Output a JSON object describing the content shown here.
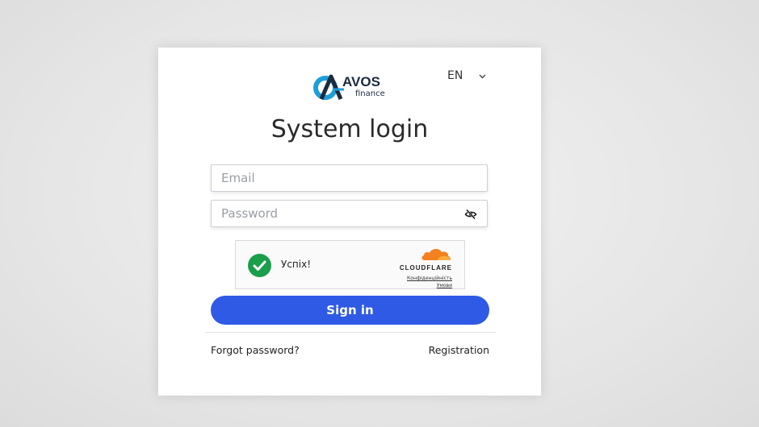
{
  "language": {
    "selected": "EN"
  },
  "logo": {
    "main": "AVOS",
    "sub": "finance",
    "colors": [
      "#1e9fd8",
      "#1b2a3f"
    ]
  },
  "title": "System login",
  "form": {
    "email_placeholder": "Email",
    "password_placeholder": "Password"
  },
  "captcha": {
    "status": "Успіх!",
    "brand": "CLOUDFLARE",
    "privacy_link": "Конфіденційність",
    "terms_link": "Умови",
    "brand_color": "#f48120",
    "success_color": "#1a9e4b"
  },
  "actions": {
    "sign_in": "Sign in",
    "forgot_password": "Forgot password?",
    "registration": "Registration",
    "accent": "#2f5ae5"
  },
  "icons": {
    "password_toggle": "eye-slash-icon",
    "success": "checkmark-circle-icon",
    "language": "chevron-down-icon"
  }
}
